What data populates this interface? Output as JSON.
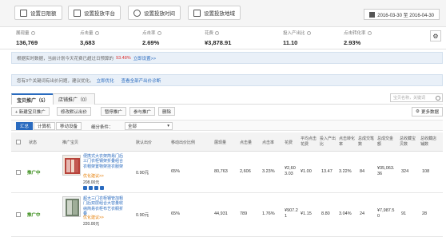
{
  "top_buttons": [
    {
      "label": "设置日限额",
      "icon": "coin-bag-icon"
    },
    {
      "label": "设置投放平台",
      "icon": "monitor-icon"
    },
    {
      "label": "设置投放时间",
      "icon": "clock-icon"
    },
    {
      "label": "设置投放地域",
      "icon": "map-icon"
    }
  ],
  "date_range": "2016-03-30 至 2016-04-30",
  "metrics": [
    {
      "label": "展现量",
      "value": "136,769"
    },
    {
      "label": "点击量",
      "value": "3,683"
    },
    {
      "label": "点击率",
      "value": "2.69%"
    },
    {
      "label": "花费",
      "value": "¥3,878.91"
    },
    {
      "label": "投入产出比",
      "value": "11.10"
    },
    {
      "label": "点击转化率",
      "value": "2.93%"
    }
  ],
  "notice1": {
    "text": "根据实时数据，当前计划今天花费已超过日预算的",
    "percent": "93.48%",
    "link": "立即设置>>"
  },
  "notice2": {
    "text": "您有3个关键词有出价问题，建议优化。",
    "link1": "立即优化",
    "link2": "查看全部产出价诊断"
  },
  "tabs": [
    {
      "label": "宝贝推广（5）",
      "active": true
    },
    {
      "label": "店铺推广（0）",
      "active": false
    }
  ],
  "search_placeholder": "宝贝名称，关键词",
  "toolbar": [
    "+ 新建宝贝推广",
    "修改默认出价",
    "暂停推广",
    "参与推广",
    "删除"
  ],
  "more_data": "更多数据",
  "filters": {
    "all": "汇总",
    "pc": "计算机",
    "mobile": "移动设备",
    "cond_label": "细分条件：",
    "select_value": "全部"
  },
  "headers": [
    "状态",
    "推广宝贝",
    "默认出价",
    "移动出价比例",
    "展现量",
    "点击量",
    "点击率",
    "花费",
    "平均点击花费",
    "投入产出比",
    "点击转化率",
    "总成交笔数",
    "总成交金额",
    "总收藏宝贝数",
    "总收藏店铺数"
  ],
  "rows": [
    {
      "status": "推广中",
      "title": "便携式大衣架简易门后三门衣柜钢架折叠组合衣帽架置物架挂衣服架",
      "orange": "优化建议>>",
      "price": "208.00元",
      "bid": "0.90元",
      "mobile_ratio": "65%",
      "impressions": "80,763",
      "clicks": "2,606",
      "ctr": "3.23%",
      "cost": "¥2,603.03",
      "avg_cpc": "¥1.00",
      "roi": "13.47",
      "cvr": "3.22%",
      "orders": "84",
      "gmv": "¥35,063.36",
      "fav_items": "324",
      "fav_shops": "108"
    },
    {
      "status": "推广中",
      "title": "超大三门衣柜钢管加粗门后双层组合大容量收纳简易衣柜布艺衣橱折叠",
      "orange": "优化建议>>",
      "price": "220.00元",
      "bid": "0.90元",
      "mobile_ratio": "65%",
      "impressions": "44,931",
      "clicks": "789",
      "ctr": "1.76%",
      "cost": "¥907.21",
      "avg_cpc": "¥1.15",
      "roi": "8.80",
      "cvr": "3.04%",
      "orders": "24",
      "gmv": "¥7,987.50",
      "fav_items": "91",
      "fav_shops": "28"
    }
  ]
}
